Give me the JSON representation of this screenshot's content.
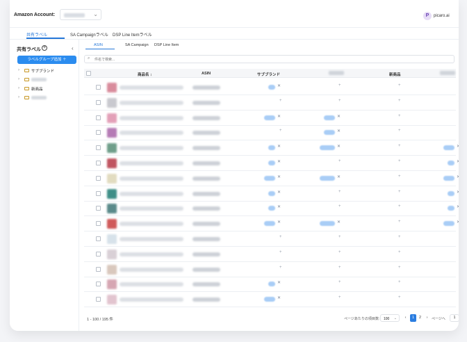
{
  "header": {
    "account_label": "Amazon Account:",
    "avatar_letter": "P",
    "user_name": "picaro.ai"
  },
  "top_tabs": [
    "共有ラベル",
    "SA Campaignラベル",
    "DSP Line Itemラベル"
  ],
  "sidebar": {
    "title": "共有ラベル",
    "add_group_button": "ラベルグループ追加 ＋",
    "tree": [
      {
        "label": "サブブランド",
        "redacted": false
      },
      {
        "label": "",
        "redacted": true
      },
      {
        "label": "新商品",
        "redacted": false
      },
      {
        "label": "",
        "redacted": true
      }
    ]
  },
  "sub_tabs": [
    "ASIN",
    "SA Campaign",
    "DSP Line Item"
  ],
  "search": {
    "placeholder": "件名で検索..."
  },
  "table": {
    "headers": {
      "product_name": "商品名 ↕",
      "asin": "ASIN",
      "sub_brand": "サブブランド",
      "new_product": "新商品"
    },
    "thumb_colors": [
      "#d98c9c",
      "#c9c9cf",
      "#e3a0b8",
      "#b57bb5",
      "#6f9e8a",
      "#c05560",
      "#e2dcc0",
      "#3f8f87",
      "#5a8a8a",
      "#d05a5a",
      "#d7e2ea",
      "#d9d0d6",
      "#d9c8bd",
      "#d6a6b2",
      "#e2c4cf"
    ],
    "rows": [
      {
        "sub": 1,
        "c2": 0,
        "c3": 0
      },
      {
        "sub": 0,
        "c2": 0,
        "c3": 0
      },
      {
        "sub": 2,
        "c2": 2,
        "c3": 0
      },
      {
        "sub": 0,
        "c2": 2,
        "c3": 0
      },
      {
        "sub": 1,
        "c2": 3,
        "c3": 2
      },
      {
        "sub": 1,
        "c2": 0,
        "c3": 1
      },
      {
        "sub": 2,
        "c2": 3,
        "c3": 2
      },
      {
        "sub": 1,
        "c2": 0,
        "c3": 1
      },
      {
        "sub": 1,
        "c2": 0,
        "c3": 1
      },
      {
        "sub": 2,
        "c2": 3,
        "c3": 2
      },
      {
        "sub": 0,
        "c2": 0,
        "c3": 0
      },
      {
        "sub": 0,
        "c2": 0,
        "c3": 0
      },
      {
        "sub": 0,
        "c2": 0,
        "c3": 0
      },
      {
        "sub": 1,
        "c2": 0,
        "c3": 0
      },
      {
        "sub": 2,
        "c2": 0,
        "c3": 0
      }
    ]
  },
  "footer": {
    "count": "1 - 100 / 195 件",
    "per_page_label": "ページあたりの項目数:",
    "per_page_value": "100",
    "pages": [
      "1",
      "2"
    ],
    "current_page": "1",
    "jump_label": "ページへ",
    "jump_value": "1",
    "prev": "‹",
    "next": "›"
  },
  "icons": {
    "search": "search-icon",
    "chevron": "chevron-down-icon",
    "plus": "plus-icon",
    "close": "close-icon",
    "folder": "folder-icon"
  }
}
